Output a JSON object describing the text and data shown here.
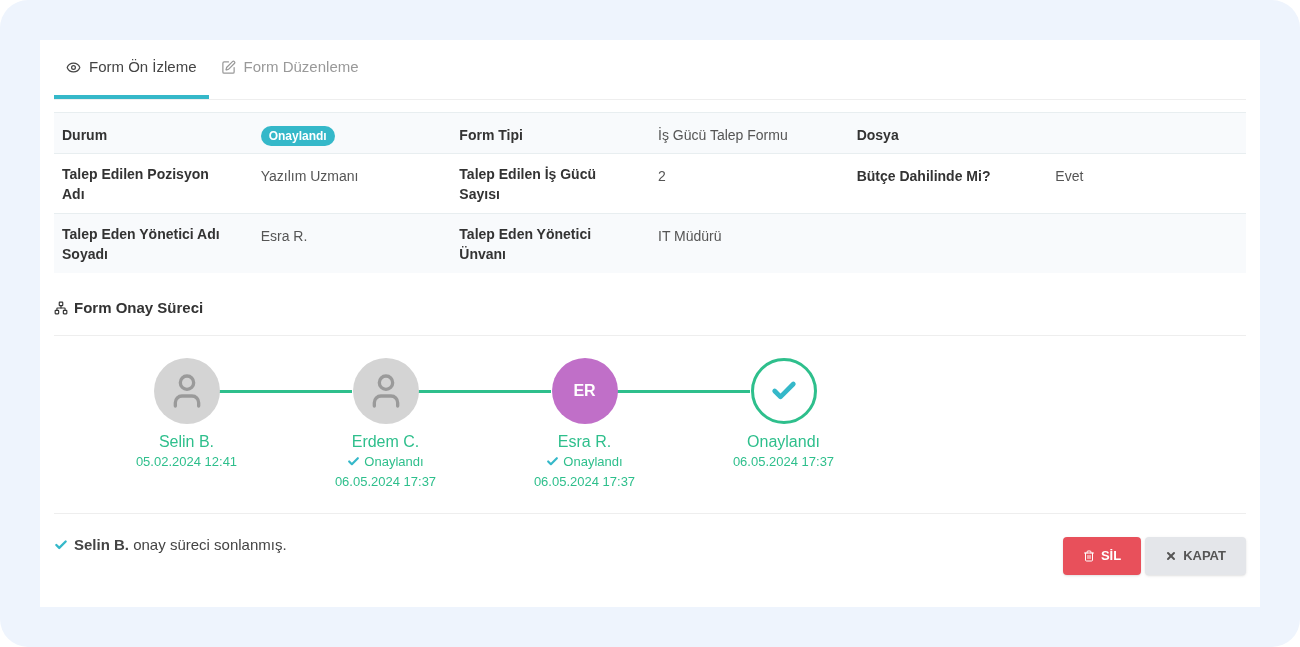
{
  "tabs": [
    {
      "label": "Form Ön İzleme",
      "kind": "preview",
      "selected": true
    },
    {
      "label": "Form Düzenleme",
      "kind": "edit",
      "selected": false
    }
  ],
  "details": {
    "rows": [
      {
        "cells": [
          {
            "label": "Durum",
            "value": "Onaylandı",
            "kind": "badge"
          },
          {
            "label": "Form Tipi",
            "value": "İş Gücü Talep Formu",
            "kind": "text"
          },
          {
            "label": "Dosya"
          }
        ]
      },
      {
        "cells": [
          {
            "label": "Talep Edilen Pozisyon Adı",
            "value": "Yazılım Uzmanı",
            "kind": "text"
          },
          {
            "label": "Talep Edilen İş Gücü Sayısı",
            "value": "2",
            "kind": "text"
          },
          {
            "label": "Bütçe Dahilinde Mi?",
            "value": "Evet",
            "kind": "text"
          }
        ]
      },
      {
        "cells": [
          {
            "label": "Talep Eden Yönetici Adı Soyadı",
            "value": "Esra R.",
            "kind": "text"
          },
          {
            "label": "Talep Eden Yönetici Ünvanı",
            "value": "IT Müdürü",
            "kind": "text"
          }
        ]
      }
    ]
  },
  "approval": {
    "title": "Form Onay Süreci",
    "steps": [
      {
        "kind": "photo",
        "name": "Selin B.",
        "date": "05.02.2024 12:41"
      },
      {
        "kind": "photo",
        "name": "Erdem C.",
        "status": "Onaylandı",
        "date": "06.05.2024 17:37"
      },
      {
        "kind": "initials",
        "initials": "ER",
        "color": "#c06fc8",
        "name": "Esra R.",
        "status": "Onaylandı",
        "date": "06.05.2024 17:37"
      },
      {
        "kind": "done",
        "name": "Onaylandı",
        "date": "06.05.2024 17:37"
      }
    ]
  },
  "footer": {
    "message": "**Selin B.** onay süreci sonlanmış.",
    "buttons": [
      {
        "label": "SİL",
        "kind": "danger"
      },
      {
        "label": "KAPAT",
        "kind": "default"
      }
    ]
  }
}
